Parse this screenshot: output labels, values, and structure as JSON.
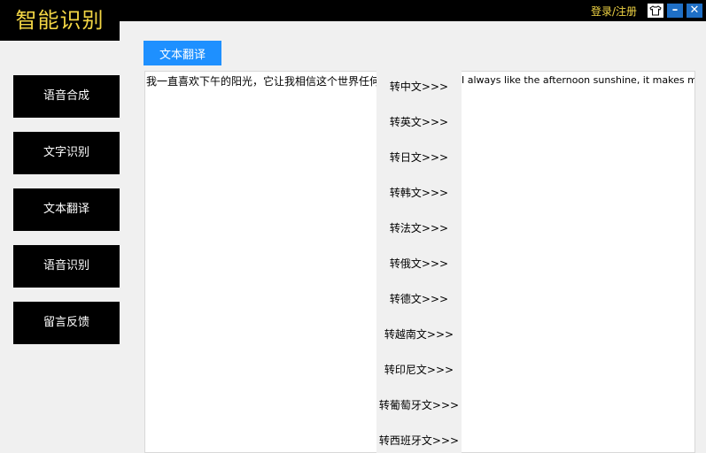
{
  "app": {
    "title": "智能识别"
  },
  "topbar": {
    "login_label": "登录/注册",
    "skin_icon": "shirt-icon",
    "minimize": "–",
    "close": "✕"
  },
  "sidebar": {
    "items": [
      {
        "label": "语音合成"
      },
      {
        "label": "文字识别"
      },
      {
        "label": "文本翻译"
      },
      {
        "label": "语音识别"
      },
      {
        "label": "留言反馈"
      }
    ]
  },
  "main": {
    "tab_label": "文本翻译",
    "source_text": "我一直喜欢下午的阳光，它让我相信这个世界任何",
    "result_text": "I always like the afternoon sunshine, it makes me believe",
    "languages": [
      "转中文>>>",
      "转英文>>>",
      "转日文>>>",
      "转韩文>>>",
      "转法文>>>",
      "转俄文>>>",
      "转德文>>>",
      "转越南文>>>",
      "转印尼文>>>",
      "转葡萄牙文>>>",
      "转西班牙文>>>"
    ]
  },
  "colors": {
    "accent": "#1e90ff",
    "title": "#f2d544",
    "window_buttons": "#1f6fc5"
  }
}
